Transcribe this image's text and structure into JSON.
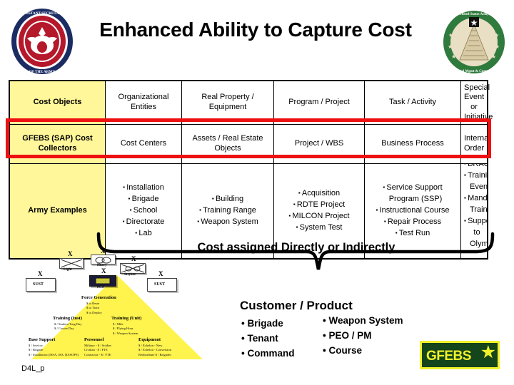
{
  "header": {
    "title": "Enhanced Ability to Capture Cost",
    "left_seal_name": "office-of-the-assistant-secretary-of-the-army-seal",
    "left_seal_text": "OFFICE OF THE ASSISTANT SECRETARY OF THE ARMY",
    "right_seal_name": "united-states-army-financial-management-comptroller-seal",
    "right_seal_text_top": "United States Army",
    "right_seal_text_bottom": "Financial Management & Comptroller"
  },
  "matrix": {
    "rows": [
      {
        "label": "Cost Objects",
        "cells": [
          "Organizational Entities",
          "Real Property / Equipment",
          "Program / Project",
          "Task / Activity",
          "Special Event or Initiative"
        ]
      },
      {
        "label": "GFEBS (SAP) Cost Collectors",
        "cells": [
          "Cost Centers",
          "Assets / Real Estate Objects",
          "Project / WBS",
          "Business Process",
          "Internal Order"
        ]
      }
    ],
    "examples_row": {
      "label": "Army Examples",
      "columns": [
        [
          "Installation",
          "Brigade",
          "School",
          "Directorate",
          "Lab"
        ],
        [
          "Building",
          "Training Range",
          "Weapon System"
        ],
        [
          "Acquisition",
          "RDTE Project",
          "MILCON Project",
          "System Test"
        ],
        [
          "Service Support Program (SSP)",
          "Instructional Course",
          "Repair Process",
          "Test Run"
        ],
        [
          "BRAC",
          "Training Event",
          "Mandatory Training",
          "Support to Olympics"
        ]
      ]
    },
    "highlight_color": "#EE1111",
    "label_cell_color": "#FFF799"
  },
  "brace": {
    "caption": "Cost assigned Directly or Indirectly"
  },
  "customer": {
    "title": "Customer / Product",
    "column_a": [
      "Brigade",
      "Tenant",
      "Command"
    ],
    "column_b": [
      "Weapon System",
      "PEO / PM",
      "Course"
    ]
  },
  "pyramid": {
    "units": [
      {
        "x": "X",
        "caption": "Light"
      },
      {
        "x": "X",
        "caption": "Heavy"
      },
      {
        "x": "X",
        "caption": "Stryker"
      },
      {
        "x": "X",
        "caption": "FCS"
      },
      {
        "x": "X",
        "caption": "SUST"
      },
      {
        "x": "X",
        "caption": "SUST"
      }
    ],
    "sections": [
      {
        "heading": "Force Generation",
        "lines": [
          "$ to Reset",
          "$ to Train",
          "$ to Deploy"
        ]
      },
      {
        "heading": "Training (Inst)",
        "lines": [
          "$ / Student Trng Day",
          "$ / Course Day"
        ]
      },
      {
        "heading": "Training (Unit)",
        "lines": [
          "$ / Mile",
          "$ / Flying Hour",
          "$ / Weapon System"
        ]
      },
      {
        "heading": "Base Support",
        "lines": [
          "$ / Service",
          "$ / Brigade",
          "$ / Installation (ISSA, ISA, BASOPS)"
        ]
      },
      {
        "heading": "Personnel",
        "lines": [
          "Military - $ / Soldier",
          "Civilian - $ / FTE",
          "Contractor - $ / FTE"
        ]
      },
      {
        "heading": "Equipment",
        "lines": [
          "$ / Echelon - New",
          "$ / Echelon - Conversion",
          "Redistribute $ / Brigades"
        ]
      }
    ]
  },
  "gfebs_logo": {
    "text": "GFEBS",
    "star": "★",
    "background": "#15451A",
    "border": "#F2F22A",
    "foreground": "#F2F22A"
  },
  "footer": {
    "slide_code": "D4L_p"
  }
}
